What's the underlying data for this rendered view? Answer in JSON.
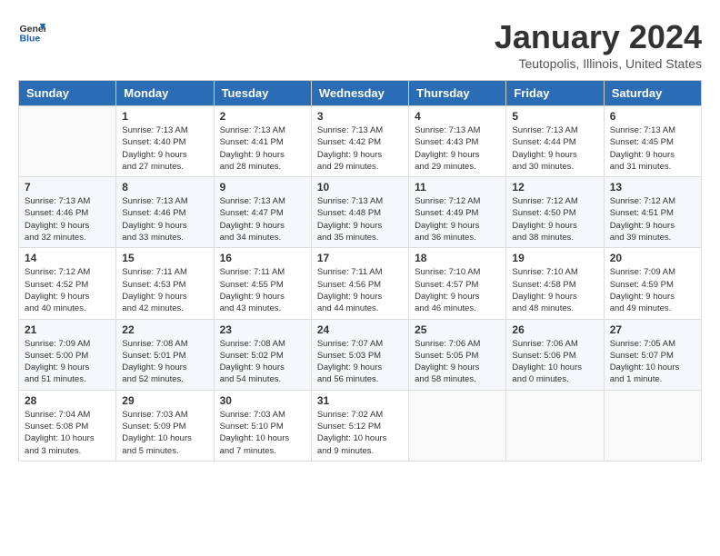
{
  "header": {
    "logo_general": "General",
    "logo_blue": "Blue",
    "month": "January 2024",
    "location": "Teutopolis, Illinois, United States"
  },
  "weekdays": [
    "Sunday",
    "Monday",
    "Tuesday",
    "Wednesday",
    "Thursday",
    "Friday",
    "Saturday"
  ],
  "weeks": [
    [
      {
        "day": "",
        "info": ""
      },
      {
        "day": "1",
        "info": "Sunrise: 7:13 AM\nSunset: 4:40 PM\nDaylight: 9 hours\nand 27 minutes."
      },
      {
        "day": "2",
        "info": "Sunrise: 7:13 AM\nSunset: 4:41 PM\nDaylight: 9 hours\nand 28 minutes."
      },
      {
        "day": "3",
        "info": "Sunrise: 7:13 AM\nSunset: 4:42 PM\nDaylight: 9 hours\nand 29 minutes."
      },
      {
        "day": "4",
        "info": "Sunrise: 7:13 AM\nSunset: 4:43 PM\nDaylight: 9 hours\nand 29 minutes."
      },
      {
        "day": "5",
        "info": "Sunrise: 7:13 AM\nSunset: 4:44 PM\nDaylight: 9 hours\nand 30 minutes."
      },
      {
        "day": "6",
        "info": "Sunrise: 7:13 AM\nSunset: 4:45 PM\nDaylight: 9 hours\nand 31 minutes."
      }
    ],
    [
      {
        "day": "7",
        "info": ""
      },
      {
        "day": "8",
        "info": "Sunrise: 7:13 AM\nSunset: 4:46 PM\nDaylight: 9 hours\nand 33 minutes."
      },
      {
        "day": "9",
        "info": "Sunrise: 7:13 AM\nSunset: 4:47 PM\nDaylight: 9 hours\nand 34 minutes."
      },
      {
        "day": "10",
        "info": "Sunrise: 7:13 AM\nSunset: 4:48 PM\nDaylight: 9 hours\nand 35 minutes."
      },
      {
        "day": "11",
        "info": "Sunrise: 7:12 AM\nSunset: 4:49 PM\nDaylight: 9 hours\nand 36 minutes."
      },
      {
        "day": "12",
        "info": "Sunrise: 7:12 AM\nSunset: 4:50 PM\nDaylight: 9 hours\nand 38 minutes."
      },
      {
        "day": "13",
        "info": "Sunrise: 7:12 AM\nSunset: 4:51 PM\nDaylight: 9 hours\nand 39 minutes."
      }
    ],
    [
      {
        "day": "14",
        "info": ""
      },
      {
        "day": "15",
        "info": "Sunrise: 7:11 AM\nSunset: 4:53 PM\nDaylight: 9 hours\nand 42 minutes."
      },
      {
        "day": "16",
        "info": "Sunrise: 7:11 AM\nSunset: 4:55 PM\nDaylight: 9 hours\nand 43 minutes."
      },
      {
        "day": "17",
        "info": "Sunrise: 7:11 AM\nSunset: 4:56 PM\nDaylight: 9 hours\nand 44 minutes."
      },
      {
        "day": "18",
        "info": "Sunrise: 7:10 AM\nSunset: 4:57 PM\nDaylight: 9 hours\nand 46 minutes."
      },
      {
        "day": "19",
        "info": "Sunrise: 7:10 AM\nSunset: 4:58 PM\nDaylight: 9 hours\nand 48 minutes."
      },
      {
        "day": "20",
        "info": "Sunrise: 7:09 AM\nSunset: 4:59 PM\nDaylight: 9 hours\nand 49 minutes."
      }
    ],
    [
      {
        "day": "21",
        "info": ""
      },
      {
        "day": "22",
        "info": "Sunrise: 7:08 AM\nSunset: 5:01 PM\nDaylight: 9 hours\nand 52 minutes."
      },
      {
        "day": "23",
        "info": "Sunrise: 7:08 AM\nSunset: 5:02 PM\nDaylight: 9 hours\nand 54 minutes."
      },
      {
        "day": "24",
        "info": "Sunrise: 7:07 AM\nSunset: 5:03 PM\nDaylight: 9 hours\nand 56 minutes."
      },
      {
        "day": "25",
        "info": "Sunrise: 7:06 AM\nSunset: 5:05 PM\nDaylight: 9 hours\nand 58 minutes."
      },
      {
        "day": "26",
        "info": "Sunrise: 7:06 AM\nSunset: 5:06 PM\nDaylight: 10 hours\nand 0 minutes."
      },
      {
        "day": "27",
        "info": "Sunrise: 7:05 AM\nSunset: 5:07 PM\nDaylight: 10 hours\nand 1 minute."
      }
    ],
    [
      {
        "day": "28",
        "info": ""
      },
      {
        "day": "29",
        "info": "Sunrise: 7:03 AM\nSunset: 5:09 PM\nDaylight: 10 hours\nand 5 minutes."
      },
      {
        "day": "30",
        "info": "Sunrise: 7:03 AM\nSunset: 5:10 PM\nDaylight: 10 hours\nand 7 minutes."
      },
      {
        "day": "31",
        "info": "Sunrise: 7:02 AM\nSunset: 5:12 PM\nDaylight: 10 hours\nand 9 minutes."
      },
      {
        "day": "",
        "info": ""
      },
      {
        "day": "",
        "info": ""
      },
      {
        "day": "",
        "info": ""
      }
    ]
  ],
  "week1_sun": "Sunrise: 7:13 AM\nSunset: 4:46 PM\nDaylight: 9 hours\nand 32 minutes.",
  "week3_sun": "Sunrise: 7:12 AM\nSunset: 4:52 PM\nDaylight: 9 hours\nand 40 minutes.",
  "week4_sun": "Sunrise: 7:09 AM\nSunset: 5:00 PM\nDaylight: 9 hours\nand 51 minutes.",
  "week5_sun": "Sunrise: 7:04 AM\nSunset: 5:08 PM\nDaylight: 10 hours\nand 3 minutes."
}
